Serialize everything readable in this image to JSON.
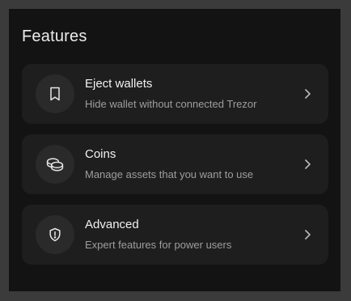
{
  "section": {
    "title": "Features"
  },
  "items": [
    {
      "title": "Eject wallets",
      "description": "Hide wallet without connected Trezor",
      "icon": "bookmark-icon"
    },
    {
      "title": "Coins",
      "description": "Manage assets that you want to use",
      "icon": "coins-icon"
    },
    {
      "title": "Advanced",
      "description": "Expert features for power users",
      "icon": "shield-alert-icon"
    }
  ],
  "colors": {
    "background": "#131313",
    "card": "#1e1e1e",
    "icon_circle": "#2a2a2a",
    "title_text": "#ececec",
    "description_text": "#9e9e9e"
  }
}
